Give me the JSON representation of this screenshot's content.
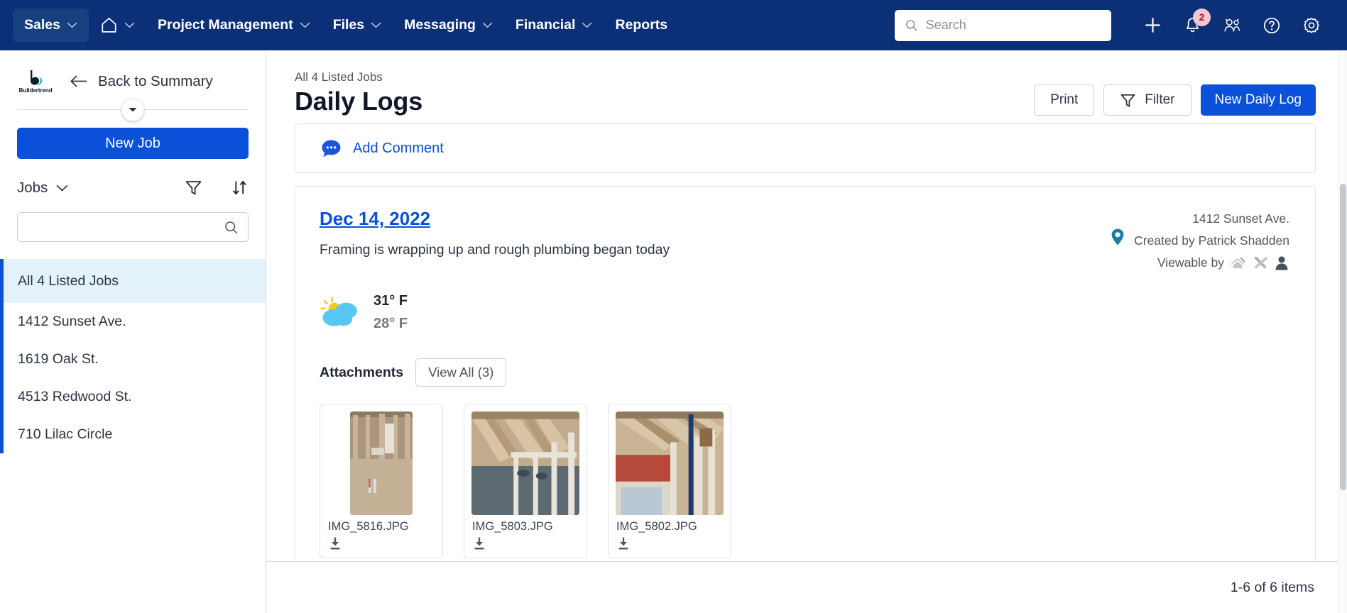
{
  "topnav": {
    "items": [
      {
        "label": "Sales",
        "has_caret": true,
        "active": true
      },
      {
        "label": "",
        "icon": "home-icon",
        "has_caret": true,
        "active": false
      },
      {
        "label": "Project Management",
        "has_caret": true,
        "active": false
      },
      {
        "label": "Files",
        "has_caret": true,
        "active": false
      },
      {
        "label": "Messaging",
        "has_caret": true,
        "active": false
      },
      {
        "label": "Financial",
        "has_caret": true,
        "active": false
      },
      {
        "label": "Reports",
        "has_caret": false,
        "active": false
      }
    ],
    "search": {
      "value": "",
      "placeholder": "Search"
    },
    "icons": [
      {
        "name": "plus-icon"
      },
      {
        "name": "bell-icon",
        "badge": "2"
      },
      {
        "name": "people-icon"
      },
      {
        "name": "help-icon"
      },
      {
        "name": "gear-icon"
      }
    ],
    "bell_badge": "2",
    "background": "#0c3078"
  },
  "sidebar": {
    "logo_word": "Buildertrend",
    "back_label": "Back to Summary",
    "new_job_label": "New Job",
    "jobs_label": "Jobs",
    "search": {
      "value": "",
      "placeholder": ""
    },
    "jobs": [
      {
        "label": "All 4 Listed Jobs",
        "selected": true
      },
      {
        "label": "1412 Sunset Ave.",
        "selected": false
      },
      {
        "label": "1619 Oak St.",
        "selected": false
      },
      {
        "label": "4513 Redwood St.",
        "selected": false
      },
      {
        "label": "710 Lilac Circle",
        "selected": false
      }
    ],
    "accent": "#0a50d8",
    "selected_bg": "#e4f2fb"
  },
  "header": {
    "breadcrumb": "All 4 Listed Jobs",
    "title": "Daily Logs",
    "print_label": "Print",
    "filter_label": "Filter",
    "new_daily_log_label": "New Daily Log"
  },
  "comment_card": {
    "add_comment_label": "Add Comment"
  },
  "log": {
    "date": "Dec 14, 2022",
    "description": "Framing is wrapping up and rough plumbing began today",
    "job_address": "1412 Sunset Ave.",
    "created_by": "Created by Patrick Shadden",
    "viewable_by_label": "Viewable by",
    "viewable_icons": [
      "subs-icon",
      "tools-icon",
      "owner-icon"
    ],
    "weather": {
      "condition": "partly-cloudy",
      "high": "31° F",
      "low": "28° F"
    },
    "attachments_label": "Attachments",
    "view_all_label": "View All (3)",
    "attachments": [
      {
        "name": "IMG_5816.JPG",
        "orientation": "portrait"
      },
      {
        "name": "IMG_5803.JPG",
        "orientation": "landscape"
      },
      {
        "name": "IMG_5802.JPG",
        "orientation": "landscape"
      }
    ]
  },
  "footer": {
    "pagination": "1-6 of 6 items"
  }
}
